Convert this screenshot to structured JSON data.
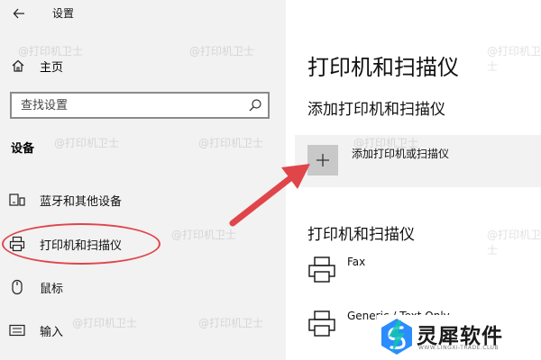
{
  "app": {
    "title": "设置"
  },
  "sidebar": {
    "home_label": "主页",
    "search_placeholder": "查找设置",
    "section_title": "设备",
    "items": [
      {
        "label": "蓝牙和其他设备",
        "icon": "devices-icon"
      },
      {
        "label": "打印机和扫描仪",
        "icon": "printer-icon"
      },
      {
        "label": "鼠标",
        "icon": "mouse-icon"
      },
      {
        "label": "输入",
        "icon": "keyboard-icon"
      }
    ]
  },
  "main": {
    "page_title": "打印机和扫描仪",
    "add_section_title": "添加打印机和扫描仪",
    "add_button_label": "添加打印机或扫描仪",
    "list_section_title": "打印机和扫描仪",
    "printers": [
      {
        "name": "Fax"
      },
      {
        "name": "Generic / Text Only"
      }
    ]
  },
  "overlay": {
    "watermark": "@打印机卫士",
    "highlight_color": "#e0454a"
  },
  "brand": {
    "name": "灵犀软件",
    "tagline": "WWW.LINGXI-TRADE.CLUB"
  }
}
